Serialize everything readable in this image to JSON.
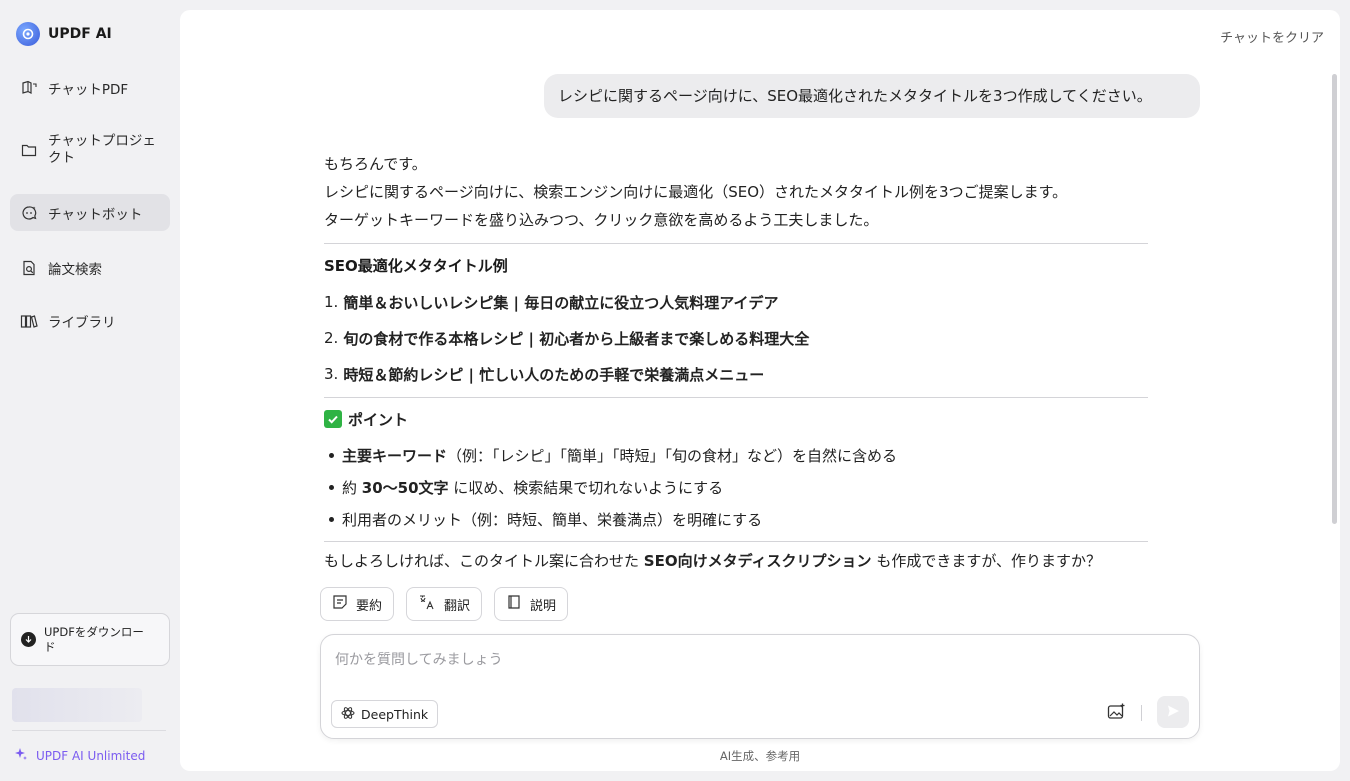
{
  "app": {
    "name": "UPDF AI"
  },
  "sidebar": {
    "items": [
      {
        "label": "チャットPDF",
        "icon": "book-chat-icon"
      },
      {
        "label": "チャットプロジェクト",
        "icon": "folder-icon"
      },
      {
        "label": "チャットボット",
        "icon": "chatbot-icon",
        "active": true
      },
      {
        "label": "論文検索",
        "icon": "paper-search-icon"
      },
      {
        "label": "ライブラリ",
        "icon": "library-icon"
      }
    ],
    "download_label": "UPDFをダウンロード",
    "unlimited_label": "UPDF AI Unlimited"
  },
  "header": {
    "clear_label": "チャットをクリア"
  },
  "chat": {
    "user_message": "レシピに関するページ向けに、SEO最適化されたメタタイトルを3つ作成してください。",
    "answer": {
      "intro": [
        "もちろんです。",
        "レシピに関するページ向けに、検索エンジン向けに最適化（SEO）されたメタタイトル例を3つご提案します。",
        "ターゲットキーワードを盛り込みつつ、クリック意欲を高めるよう工夫しました。"
      ],
      "section_title": "SEO最適化メタタイトル例",
      "titles": [
        {
          "num": "1.",
          "text": "簡単＆おいしいレシピ集 | 毎日の献立に役立つ人気料理アイデア"
        },
        {
          "num": "2.",
          "text": "旬の食材で作る本格レシピ | 初心者から上級者まで楽しめる料理大全"
        },
        {
          "num": "3.",
          "text": "時短＆節約レシピ | 忙しい人のための手軽で栄養満点メニュー"
        }
      ],
      "points_title": "ポイント",
      "points": [
        {
          "bold": "主要キーワード",
          "rest": "（例：「レシピ」「簡単」「時短」「旬の食材」など）を自然に含める"
        },
        {
          "pre": "約 ",
          "bold": "30〜50文字",
          "rest": " に収め、検索結果で切れないようにする"
        },
        {
          "rest": "利用者のメリット（例：時短、簡単、栄養満点）を明確にする"
        }
      ],
      "closing": {
        "pre": "もしよろしければ、このタイトル案に合わせた ",
        "bold": "SEO向けメタディスクリプション",
        "post": " も作成できますが、作りますか？"
      }
    }
  },
  "actions": [
    {
      "label": "要約",
      "icon": "summarize-icon"
    },
    {
      "label": "翻訳",
      "icon": "translate-icon"
    },
    {
      "label": "説明",
      "icon": "explain-icon"
    }
  ],
  "input": {
    "placeholder": "何かを質問してみましょう",
    "deepthink_label": "DeepThink"
  },
  "footer": {
    "note": "AI生成、参考用"
  },
  "colors": {
    "accent": "#7b5cf0",
    "check": "#2fb344",
    "active_bg": "#e2e2e6"
  }
}
